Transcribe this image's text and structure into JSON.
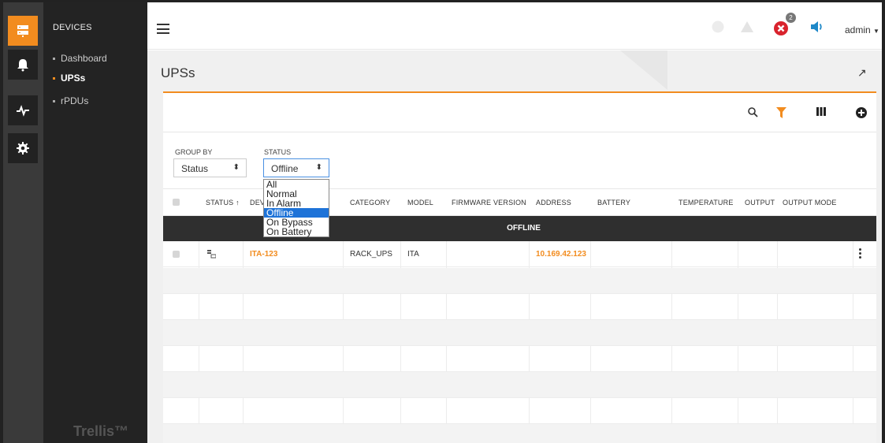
{
  "nav": {
    "title": "DEVICES",
    "items": [
      {
        "label": "Dashboard",
        "active": false
      },
      {
        "label": "UPSs",
        "active": true
      },
      {
        "label": "rPDUs",
        "active": false
      }
    ],
    "logo": "Trellis™"
  },
  "header": {
    "alarm_badge": "2",
    "user": "admin"
  },
  "page": {
    "title": "UPSs"
  },
  "filters": {
    "group_by_label": "GROUP BY",
    "group_by_value": "Status",
    "status_label": "STATUS",
    "status_value": "Offline",
    "status_options": [
      "All",
      "Normal",
      "In Alarm",
      "Offline",
      "On Bypass",
      "On Battery"
    ]
  },
  "table": {
    "columns": [
      "STATUS ↑",
      "DEVI",
      "CATEGORY",
      "MODEL",
      "FIRMWARE VERSION",
      "ADDRESS",
      "BATTERY",
      "TEMPERATURE",
      "OUTPUT",
      "OUTPUT MODE"
    ],
    "group": "OFFLINE",
    "rows": [
      {
        "device": "ITA-123",
        "category": "RACK_UPS",
        "model": "ITA",
        "firmware": "",
        "address": "10.169.42.123",
        "battery": "",
        "temperature": "",
        "output": "",
        "output_mode": ""
      }
    ]
  },
  "colors": {
    "accent": "#f28c1f",
    "error": "#d9232d",
    "info": "#1e88c8",
    "dark": "#2f2f2f"
  }
}
